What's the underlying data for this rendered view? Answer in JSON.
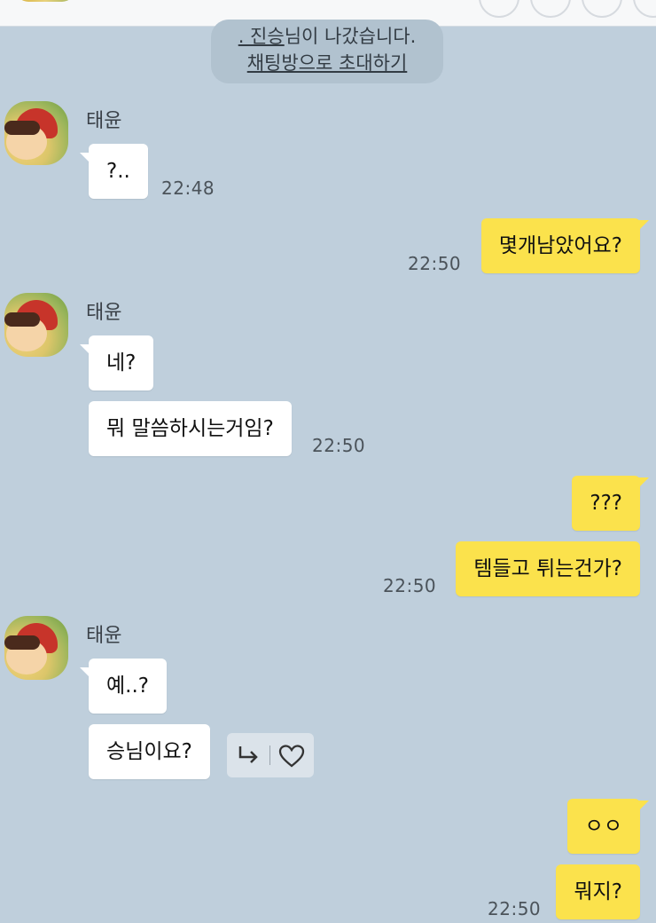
{
  "system_notice": {
    "line1_name": ". 진승",
    "line1_rest": "님이 나갔습니다.",
    "invite_link": "채팅방으로 초대하기"
  },
  "messages": {
    "g1": {
      "sender": "태윤",
      "bubble1": "?..",
      "time": "22:48"
    },
    "o1": {
      "bubble1": "몇개남았어요?",
      "time": "22:50"
    },
    "g2": {
      "sender": "태윤",
      "bubble1": "네?",
      "bubble2": "뭐 말씀하시는거임?",
      "time": "22:50"
    },
    "o2": {
      "bubble1": "???",
      "bubble2": "템들고 튀는건가?",
      "time": "22:50"
    },
    "g3": {
      "sender": "태윤",
      "bubble1": "예..?",
      "bubble2": "승님이요?"
    },
    "o3": {
      "bubble1": "ㅇㅇ",
      "bubble2": "뭐지?",
      "time": "22:50"
    }
  },
  "icons": [
    "reply-icon",
    "heart-icon"
  ],
  "colors": {
    "background": "#bfcfdc",
    "outgoing_bubble": "#fbe24c",
    "incoming_bubble": "#ffffff"
  }
}
